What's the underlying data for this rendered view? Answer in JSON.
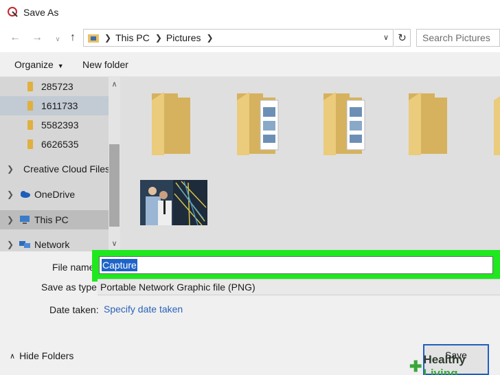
{
  "window": {
    "title": "Save As"
  },
  "navigation": {
    "breadcrumb": [
      "This PC",
      "Pictures"
    ],
    "search_placeholder": "Search Pictures"
  },
  "toolbar": {
    "organize_label": "Organize",
    "new_folder_label": "New folder"
  },
  "nav_pane": {
    "items": [
      {
        "label": "285723",
        "icon": "folder-icon"
      },
      {
        "label": "1611733",
        "icon": "folder-icon",
        "selected": true
      },
      {
        "label": "5582393",
        "icon": "folder-icon"
      },
      {
        "label": "6626535",
        "icon": "folder-icon"
      },
      {
        "label": "Creative Cloud Files",
        "icon": "creative-cloud-icon"
      },
      {
        "label": "OneDrive",
        "icon": "onedrive-icon"
      },
      {
        "label": "This PC",
        "icon": "this-pc-icon",
        "hover": true
      },
      {
        "label": "Network",
        "icon": "network-icon"
      }
    ]
  },
  "form": {
    "file_name_label": "File name:",
    "file_name_value": "Capture",
    "save_as_type_label": "Save as type:",
    "save_as_type_value": "Portable Network Graphic file (PNG)",
    "date_taken_label": "Date taken:",
    "date_taken_link": "Specify date taken"
  },
  "footer": {
    "hide_folders_label": "Hide Folders",
    "save_label": "Save"
  },
  "watermark": {
    "brand_a": "Healthy ",
    "brand_b": "Living"
  },
  "colors": {
    "highlight": "#1fe81f",
    "folder": "#e8c16a",
    "link": "#2a62b8",
    "selection": "#1e64c8"
  }
}
